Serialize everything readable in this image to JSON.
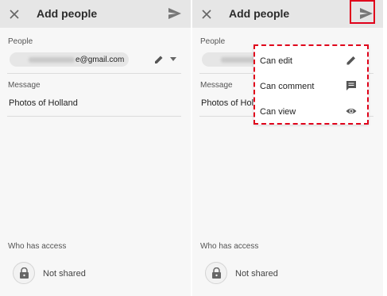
{
  "screen": {
    "title": "Add people",
    "people_label": "People",
    "email_suffix": "e@gmail.com",
    "message_label": "Message",
    "message_value": "Photos of Holland",
    "access_label": "Who has access",
    "access_status": "Not shared"
  },
  "share_menu": {
    "items": [
      {
        "label": "Can edit",
        "icon": "pencil-icon"
      },
      {
        "label": "Can comment",
        "icon": "comment-icon"
      },
      {
        "label": "Can view",
        "icon": "eye-icon"
      }
    ]
  },
  "colors": {
    "highlight": "#e0001b",
    "topbar": "#e6e6e6",
    "icon": "#666666"
  }
}
